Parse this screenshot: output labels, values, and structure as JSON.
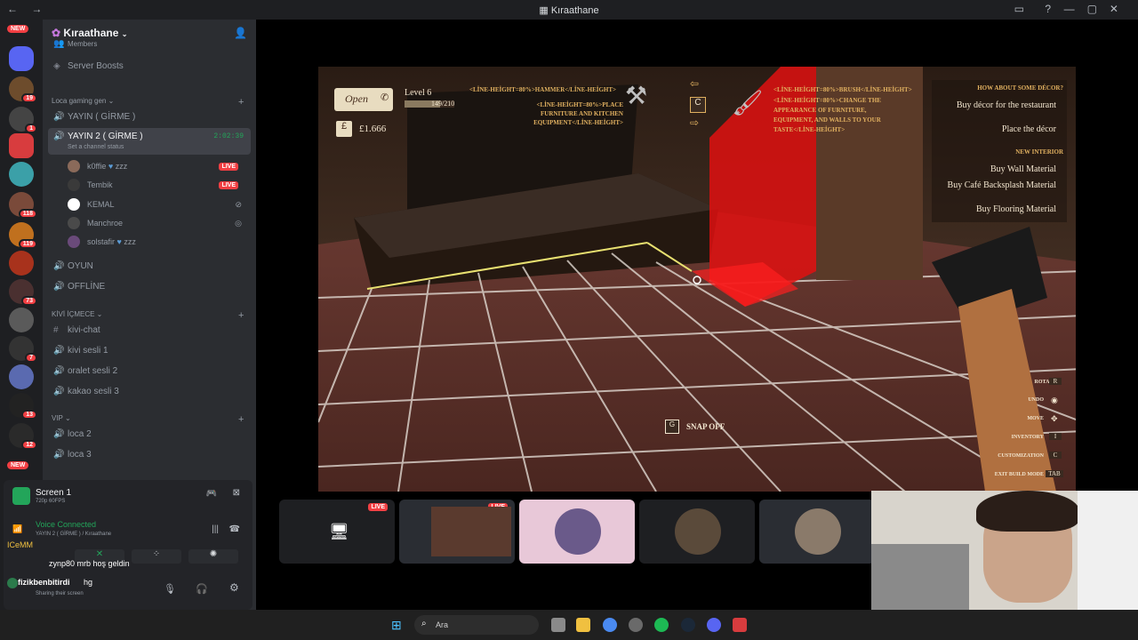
{
  "window": {
    "title": "Kıraathane"
  },
  "server": {
    "name": "Kıraathane"
  },
  "channels": {
    "members_partial": "Members",
    "server_boosts": "Server Boosts",
    "cat_loca": "Loca gaming gen",
    "yayin1": "YAYIN ( GİRME )",
    "yayin2": "YAYIN 2 ( GİRME )",
    "yayin2_time": "2:02:39",
    "yayin2_status": "Set a channel status",
    "oyun": "OYUN",
    "offline": "OFFLİNE",
    "cat_kivi": "KİVİ İÇMECE",
    "kivi_chat": "kivi-chat",
    "kivi_sesli": "kivi sesli 1",
    "oralet": "oralet sesli 2",
    "kakao": "kakao sesli 3",
    "cat_vip": "VIP",
    "loca2": "loca 2",
    "loca3": "loca 3"
  },
  "voice_users": [
    {
      "name": "k0ffie",
      "status": "zzz",
      "live": "LIVE"
    },
    {
      "name": "Tembik",
      "status": "",
      "live": "LIVE"
    },
    {
      "name": "KEMAL",
      "status": "",
      "live": ""
    },
    {
      "name": "Manchroe",
      "status": "",
      "live": ""
    },
    {
      "name": "solstafir",
      "status": "zzz",
      "live": ""
    }
  ],
  "badges": {
    "new": "NEW",
    "s1": "128",
    "s2": "19",
    "s3": "1",
    "s5": "118",
    "s6": "119",
    "s7": "73",
    "s8": "3",
    "s9": "7",
    "s11": "13",
    "s12": "12"
  },
  "panel": {
    "screen_title": "Screen 1",
    "screen_sub": "720p 60FPS",
    "voice_connected": "Voice Connected",
    "voice_channel": "YAYIN 2 ( GİRME ) / Kıraathane",
    "chat1_user": "ICeMM",
    "chat2_user": "zynp80",
    "chat2_msg": "mrb hoş geldin",
    "user_name": "fizikbenbitirdi",
    "user_msg": "hg",
    "user_sub": "Sharing their screen"
  },
  "game": {
    "open_sign": "Open",
    "level": "Level 6",
    "xp": "149/210",
    "money": "£1.666",
    "hammer_tip": "<LİNE-HEİGHT=80%>HAMMER</LİNE-HEİGHT>",
    "hammer_desc": "<LİNE-HEİGHT=80%>PLACE FURNITURE AND KITCHEN EQUIPMENT</LİNE-HEİGHT>",
    "brush_tip": "<LİNE-HEİGHT=80%>BRUSH</LİNE-HEİGHT>",
    "brush_desc": "<LİNE-HEİGHT=80%>CHANGE THE APPEARANCE OF FURNITURE, EQUIPMENT, AND WALLS TO YOUR TASTE</LİNE-HEİGHT>",
    "c_key": "C",
    "how_about": "HOW ABOUT SOME DÉCOR?",
    "buy_decor": "Buy décor for the restaurant",
    "place_decor": "Place the décor",
    "new_interior": "NEW INTERIOR",
    "buy_wall": "Buy Wall Material",
    "buy_backsplash": "Buy Café Backsplash Material",
    "buy_flooring": "Buy Flooring Material",
    "snap_key": "G",
    "snap_off": "SNAP OFF",
    "controls": [
      {
        "label": "ROTATE",
        "key": "R"
      },
      {
        "label": "UNDO",
        "key": ""
      },
      {
        "label": "MOVE",
        "key": ""
      },
      {
        "label": "INVENTORY",
        "key": "I"
      },
      {
        "label": "CUSTOMIZATION",
        "key": "C"
      },
      {
        "label": "EXIT BUILD MODE",
        "key": "TAB"
      }
    ]
  },
  "tiles": {
    "live": "LIVE"
  },
  "taskbar": {
    "search": "Ara"
  },
  "colors": {
    "accent": "#23a55a",
    "live": "#f23f43",
    "discord_bg": "#2b2d31",
    "game_red": "#e01010",
    "hud_gold": "#e0b060"
  }
}
